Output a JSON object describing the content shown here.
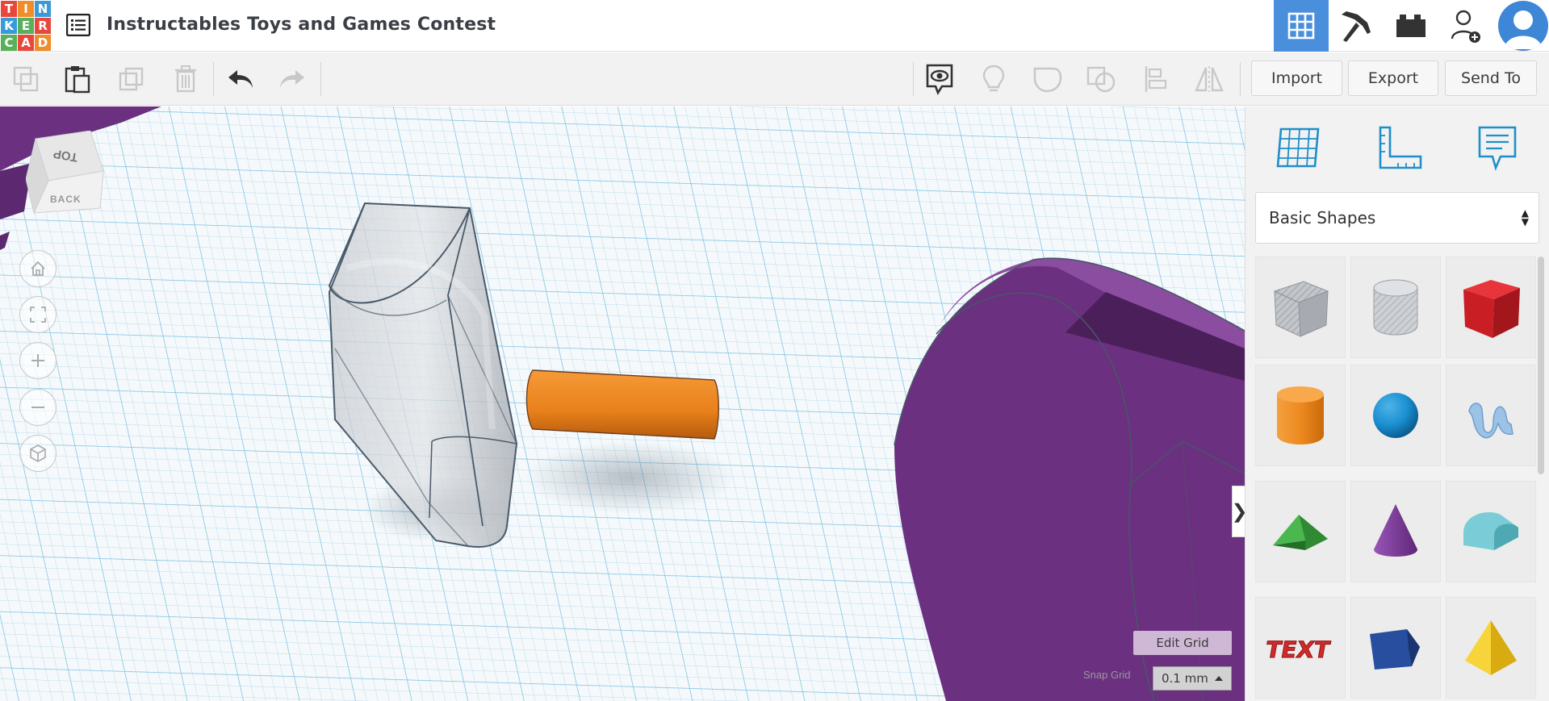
{
  "logo": {
    "letters": [
      "T",
      "I",
      "N",
      "K",
      "E",
      "R",
      "C",
      "A",
      "D"
    ]
  },
  "header": {
    "title": "Instructables Toys and Games Contest"
  },
  "toolbar": {
    "import_label": "Import",
    "export_label": "Export",
    "send_to_label": "Send To"
  },
  "viewcube": {
    "top_label": "TOP",
    "back_label": "BACK"
  },
  "workplane": {
    "edit_grid_label": "Edit Grid",
    "snap_grid_label": "Snap Grid",
    "snap_grid_value": "0.1 mm"
  },
  "panel": {
    "collapse_label": "❯",
    "category": "Basic Shapes",
    "shapes": [
      {
        "name": "box-hole",
        "color": "#b8bcc2"
      },
      {
        "name": "cylinder-hole",
        "color": "#c4c7cc"
      },
      {
        "name": "box",
        "color": "#d42127"
      },
      {
        "name": "cylinder",
        "color": "#f08a1e"
      },
      {
        "name": "sphere",
        "color": "#1a8fd1"
      },
      {
        "name": "scribble",
        "color": "#8fb8e0"
      },
      {
        "name": "roof",
        "color": "#3aa43f"
      },
      {
        "name": "cone",
        "color": "#7d3a9a"
      },
      {
        "name": "round-roof",
        "color": "#6cc4cf"
      },
      {
        "name": "text",
        "color": "#d12a2a"
      },
      {
        "name": "polygon",
        "color": "#23428c"
      },
      {
        "name": "pyramid",
        "color": "#f2c91c"
      }
    ]
  },
  "colors": {
    "accent": "#4a8fdc",
    "purple_shape": "#6b3080",
    "orange_shape": "#f08a1e",
    "edit_grid_bg": "#cfb8d5"
  }
}
